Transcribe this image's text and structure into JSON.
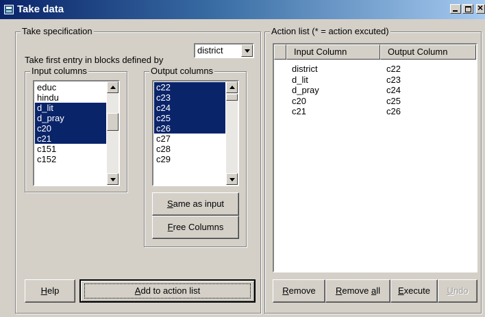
{
  "window": {
    "title": "Take data"
  },
  "spec": {
    "legend": "Take specification",
    "first_entry_label": "Take first entry in blocks defined by",
    "block_var": "district",
    "input_legend": "Input columns",
    "output_legend": "Output columns",
    "input_items": [
      {
        "label": "educ",
        "selected": false
      },
      {
        "label": "hindu",
        "selected": false
      },
      {
        "label": "d_lit",
        "selected": true
      },
      {
        "label": "d_pray",
        "selected": true
      },
      {
        "label": "c20",
        "selected": true
      },
      {
        "label": "c21",
        "selected": true
      },
      {
        "label": "c151",
        "selected": false
      },
      {
        "label": "c152",
        "selected": false
      }
    ],
    "output_items": [
      {
        "label": "c22",
        "selected": true
      },
      {
        "label": "c23",
        "selected": true
      },
      {
        "label": "c24",
        "selected": true
      },
      {
        "label": "c25",
        "selected": true
      },
      {
        "label": "c26",
        "selected": true
      },
      {
        "label": "c27",
        "selected": false
      },
      {
        "label": "c28",
        "selected": false
      },
      {
        "label": "c29",
        "selected": false
      }
    ],
    "same_as_input_label": "Same as input",
    "free_columns_label": "Free Columns"
  },
  "actions": {
    "legend": "Action list (* = action excuted)",
    "col_input": "Input Column",
    "col_output": "Output Column",
    "rows": [
      {
        "input": "district",
        "output": "c22"
      },
      {
        "input": "d_lit",
        "output": "c23"
      },
      {
        "input": "d_pray",
        "output": "c24"
      },
      {
        "input": "c20",
        "output": "c25"
      },
      {
        "input": "c21",
        "output": "c26"
      }
    ]
  },
  "buttons": {
    "help": "Help",
    "add": "Add to action list",
    "remove": "Remove",
    "remove_all": "Remove all",
    "execute": "Execute",
    "undo": "Undo"
  }
}
